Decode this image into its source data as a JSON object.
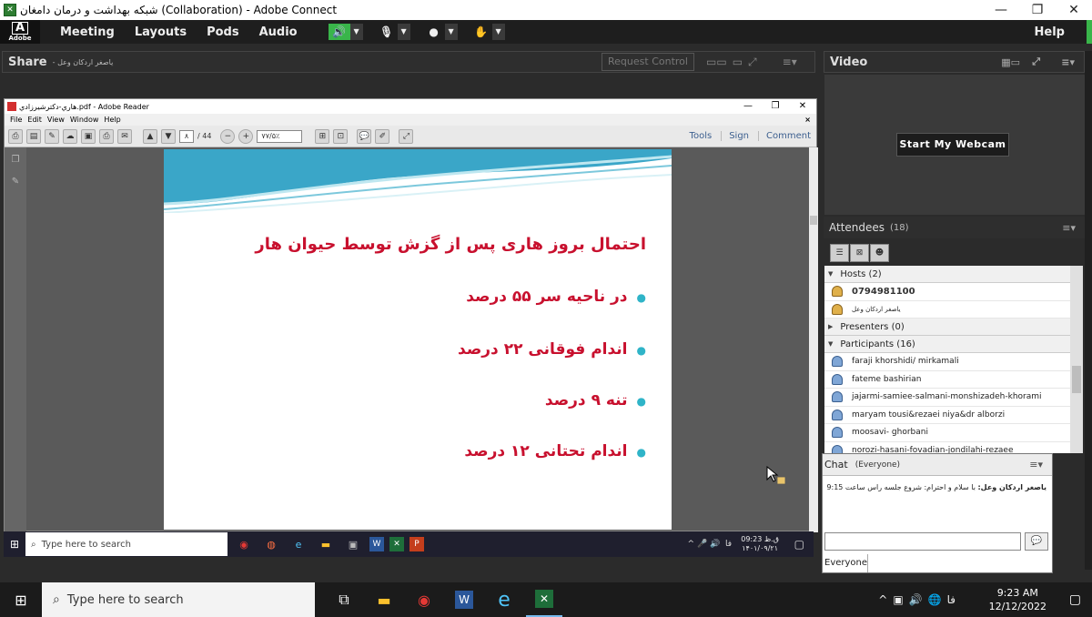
{
  "window": {
    "title": "شبکه بهداشت و درمان دامغان (Collaboration) - Adobe Connect",
    "app_icon": "adobe-connect-icon",
    "controls": [
      "—",
      "❐",
      "✕"
    ]
  },
  "menubar": {
    "logo_letter": "A",
    "logo_text": "Adobe",
    "items": [
      "Meeting",
      "Layouts",
      "Pods",
      "Audio"
    ],
    "help": "Help",
    "accent": "#39b54a"
  },
  "share_pod": {
    "title": "Share",
    "presenter": "- ياصغر اردکان وعل",
    "request_control": "Request Control"
  },
  "reader": {
    "title": "هاري-دكترشيرزادي.pdf - Adobe Reader",
    "menu": [
      "File",
      "Edit",
      "View",
      "Window",
      "Help"
    ],
    "page_current": "۸",
    "page_total": "/ 44",
    "zoom": "۷۷/۵٪",
    "tools_links": [
      "Tools",
      "Sign",
      "Comment"
    ]
  },
  "slide": {
    "title": "احتمال بروز هاری  پس از گزش توسط حیوان هار",
    "bullets": [
      "در ناحیه سر ۵۵ درصد",
      "اندام فوقانی ۲۲ درصد",
      "تنه ۹ درصد",
      "اندام تحتانی ۱۲ درصد"
    ],
    "title_color": "#c8102e",
    "bullet_color": "#2fb4c8"
  },
  "inner_taskbar": {
    "search_placeholder": "Type here to search",
    "time": "09:23 ق.ظ",
    "date": "۱۴۰۱/۰۹/۲۱",
    "lang": "فا"
  },
  "video_pod": {
    "title": "Video",
    "start_webcam": "Start My Webcam"
  },
  "attendees_pod": {
    "title": "Attendees",
    "count": "(18)",
    "groups": [
      {
        "label": "Hosts (2)",
        "expanded": true,
        "members": [
          "0794981100",
          "ياصغر اردكان وعل"
        ]
      },
      {
        "label": "Presenters (0)",
        "expanded": false,
        "members": []
      },
      {
        "label": "Participants (16)",
        "expanded": true,
        "members": [
          "faraji khorshidi/ mirkamali",
          "fateme bashirian",
          "jajarmi-samiee-salmani-monshizadeh-khorami",
          "maryam tousi&rezaei niya&dr alborzi",
          "moosavi- ghorbani",
          "norozi-hasani-fovadian-jondilahi-rezaee"
        ]
      }
    ]
  },
  "chat_pod": {
    "title": "Chat",
    "scope": "(Everyone)",
    "message_sender": "ياصغر اردكان وعل:",
    "message_text": "با سلام و احترام: شروع جلسه راس ساعت 9:15",
    "recipient": "Everyone"
  },
  "taskbar": {
    "search_placeholder": "Type here to search",
    "time": "9:23 AM",
    "date": "12/12/2022",
    "lang": "فا",
    "apps": [
      "task-view-icon",
      "file-explorer-icon",
      "chrome-icon",
      "word-icon",
      "edge-icon",
      "adobe-connect-icon"
    ]
  }
}
